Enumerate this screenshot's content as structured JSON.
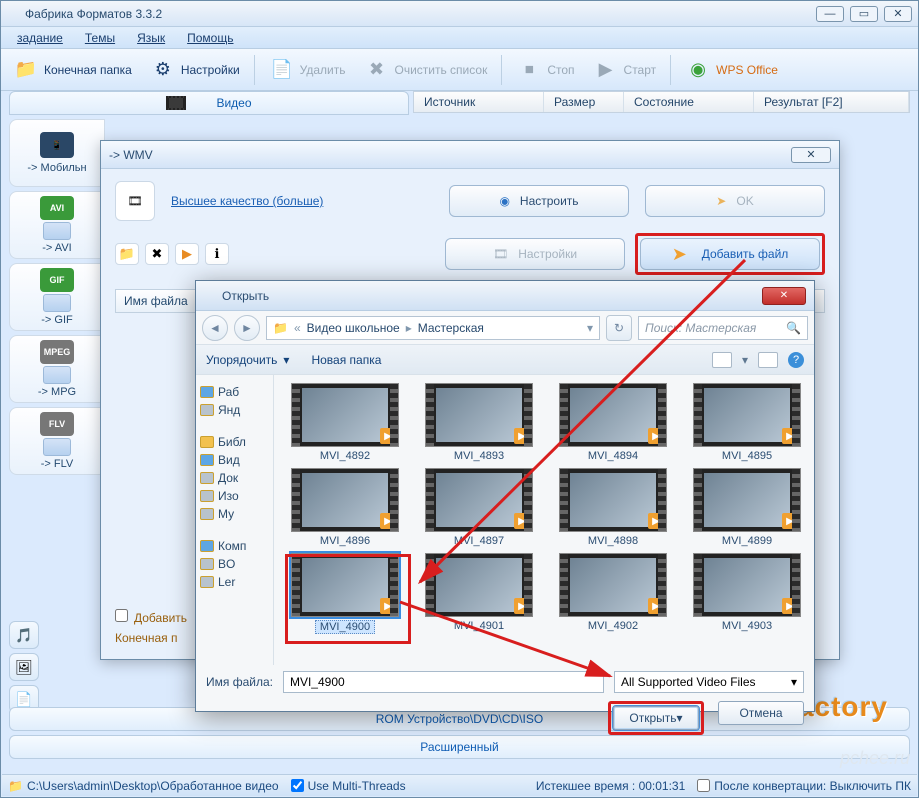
{
  "window": {
    "title": "Фабрика Форматов 3.3.2"
  },
  "menubar": {
    "task": "задание",
    "themes": "Темы",
    "language": "Язык",
    "help": "Помощь"
  },
  "toolbar": {
    "outfolder": "Конечная папка",
    "settings": "Настройки",
    "delete": "Удалить",
    "clear": "Очистить список",
    "stop": "Стоп",
    "start": "Старт",
    "wps": "WPS Office"
  },
  "columns": {
    "source": "Источник",
    "size": "Размер",
    "state": "Состояние",
    "result": "Результат [F2]"
  },
  "videoTab": "Видео",
  "formats": {
    "mobile": "-> Мобильн",
    "avi_badge": "AVI",
    "avi": "-> AVI",
    "gif_badge": "GIF",
    "gif": "-> GIF",
    "mpeg_badge": "MPEG",
    "mpg": "-> MPG",
    "flv_badge": "FLV",
    "flv": "-> FLV"
  },
  "wmv": {
    "title": "-> WMV",
    "quality": "Высшее качество (больше)",
    "configure": "Настроить",
    "ok": "OK",
    "settings": "Настройки",
    "addfile": "Добавить файл",
    "filename_col": "Имя файла",
    "add_opt": "Добавить",
    "endfolder": "Конечная п"
  },
  "open": {
    "title": "Открыть",
    "bc1": "Видео школьное",
    "bc2": "Мастерская",
    "search_ph": "Поиск: Мастерская",
    "organize": "Упорядочить",
    "newfolder": "Новая папка",
    "filename_label": "Имя файла:",
    "filename_value": "MVI_4900",
    "filter": "All Supported Video Files",
    "btn_open": "Открыть",
    "btn_cancel": "Отмена",
    "tree": {
      "desk": "Раб",
      "ya": "Янд",
      "lib": "Библ",
      "vid": "Вид",
      "doc": "Док",
      "img": "Изо",
      "mu": "Му",
      "comp": "Комп",
      "bo": "BO",
      "ler": "Ler"
    },
    "files": [
      "MVI_4892",
      "MVI_4893",
      "MVI_4894",
      "MVI_4895",
      "MVI_4896",
      "MVI_4897",
      "MVI_4898",
      "MVI_4899",
      "MVI_4900",
      "MVI_4901",
      "MVI_4902",
      "MVI_4903"
    ],
    "selected_index": 8
  },
  "bottom": {
    "rom": "ROM Устройство\\DVD\\CD\\ISO",
    "advanced": "Расширенный"
  },
  "status": {
    "path": "C:\\Users\\admin\\Desktop\\Обработанное видео",
    "threads": "Use Multi-Threads",
    "elapsed": "Истекшее время : 00:01:31",
    "after": "После конвертации: Выключить ПК"
  },
  "brand": "Factory",
  "watermark": "pchee.ru"
}
